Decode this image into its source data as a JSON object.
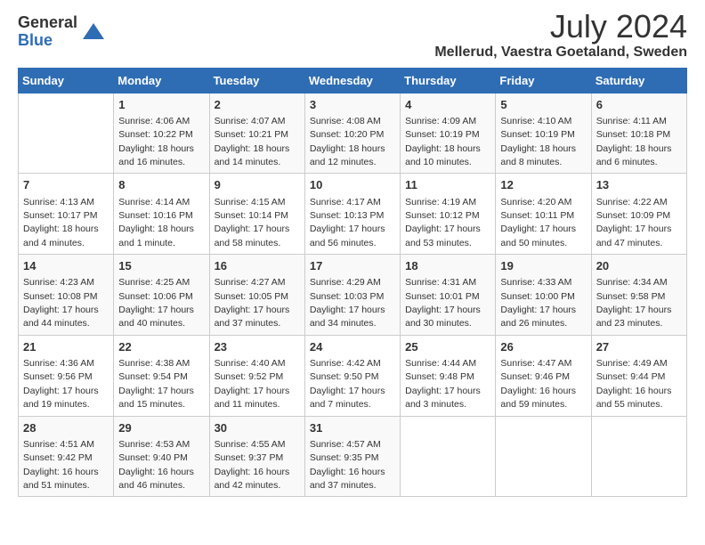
{
  "logo": {
    "general": "General",
    "blue": "Blue"
  },
  "title": "July 2024",
  "location": "Mellerud, Vaestra Goetaland, Sweden",
  "days_of_week": [
    "Sunday",
    "Monday",
    "Tuesday",
    "Wednesday",
    "Thursday",
    "Friday",
    "Saturday"
  ],
  "weeks": [
    [
      {
        "day": "",
        "info": ""
      },
      {
        "day": "1",
        "info": "Sunrise: 4:06 AM\nSunset: 10:22 PM\nDaylight: 18 hours\nand 16 minutes."
      },
      {
        "day": "2",
        "info": "Sunrise: 4:07 AM\nSunset: 10:21 PM\nDaylight: 18 hours\nand 14 minutes."
      },
      {
        "day": "3",
        "info": "Sunrise: 4:08 AM\nSunset: 10:20 PM\nDaylight: 18 hours\nand 12 minutes."
      },
      {
        "day": "4",
        "info": "Sunrise: 4:09 AM\nSunset: 10:19 PM\nDaylight: 18 hours\nand 10 minutes."
      },
      {
        "day": "5",
        "info": "Sunrise: 4:10 AM\nSunset: 10:19 PM\nDaylight: 18 hours\nand 8 minutes."
      },
      {
        "day": "6",
        "info": "Sunrise: 4:11 AM\nSunset: 10:18 PM\nDaylight: 18 hours\nand 6 minutes."
      }
    ],
    [
      {
        "day": "7",
        "info": "Sunrise: 4:13 AM\nSunset: 10:17 PM\nDaylight: 18 hours\nand 4 minutes."
      },
      {
        "day": "8",
        "info": "Sunrise: 4:14 AM\nSunset: 10:16 PM\nDaylight: 18 hours\nand 1 minute."
      },
      {
        "day": "9",
        "info": "Sunrise: 4:15 AM\nSunset: 10:14 PM\nDaylight: 17 hours\nand 58 minutes."
      },
      {
        "day": "10",
        "info": "Sunrise: 4:17 AM\nSunset: 10:13 PM\nDaylight: 17 hours\nand 56 minutes."
      },
      {
        "day": "11",
        "info": "Sunrise: 4:19 AM\nSunset: 10:12 PM\nDaylight: 17 hours\nand 53 minutes."
      },
      {
        "day": "12",
        "info": "Sunrise: 4:20 AM\nSunset: 10:11 PM\nDaylight: 17 hours\nand 50 minutes."
      },
      {
        "day": "13",
        "info": "Sunrise: 4:22 AM\nSunset: 10:09 PM\nDaylight: 17 hours\nand 47 minutes."
      }
    ],
    [
      {
        "day": "14",
        "info": "Sunrise: 4:23 AM\nSunset: 10:08 PM\nDaylight: 17 hours\nand 44 minutes."
      },
      {
        "day": "15",
        "info": "Sunrise: 4:25 AM\nSunset: 10:06 PM\nDaylight: 17 hours\nand 40 minutes."
      },
      {
        "day": "16",
        "info": "Sunrise: 4:27 AM\nSunset: 10:05 PM\nDaylight: 17 hours\nand 37 minutes."
      },
      {
        "day": "17",
        "info": "Sunrise: 4:29 AM\nSunset: 10:03 PM\nDaylight: 17 hours\nand 34 minutes."
      },
      {
        "day": "18",
        "info": "Sunrise: 4:31 AM\nSunset: 10:01 PM\nDaylight: 17 hours\nand 30 minutes."
      },
      {
        "day": "19",
        "info": "Sunrise: 4:33 AM\nSunset: 10:00 PM\nDaylight: 17 hours\nand 26 minutes."
      },
      {
        "day": "20",
        "info": "Sunrise: 4:34 AM\nSunset: 9:58 PM\nDaylight: 17 hours\nand 23 minutes."
      }
    ],
    [
      {
        "day": "21",
        "info": "Sunrise: 4:36 AM\nSunset: 9:56 PM\nDaylight: 17 hours\nand 19 minutes."
      },
      {
        "day": "22",
        "info": "Sunrise: 4:38 AM\nSunset: 9:54 PM\nDaylight: 17 hours\nand 15 minutes."
      },
      {
        "day": "23",
        "info": "Sunrise: 4:40 AM\nSunset: 9:52 PM\nDaylight: 17 hours\nand 11 minutes."
      },
      {
        "day": "24",
        "info": "Sunrise: 4:42 AM\nSunset: 9:50 PM\nDaylight: 17 hours\nand 7 minutes."
      },
      {
        "day": "25",
        "info": "Sunrise: 4:44 AM\nSunset: 9:48 PM\nDaylight: 17 hours\nand 3 minutes."
      },
      {
        "day": "26",
        "info": "Sunrise: 4:47 AM\nSunset: 9:46 PM\nDaylight: 16 hours\nand 59 minutes."
      },
      {
        "day": "27",
        "info": "Sunrise: 4:49 AM\nSunset: 9:44 PM\nDaylight: 16 hours\nand 55 minutes."
      }
    ],
    [
      {
        "day": "28",
        "info": "Sunrise: 4:51 AM\nSunset: 9:42 PM\nDaylight: 16 hours\nand 51 minutes."
      },
      {
        "day": "29",
        "info": "Sunrise: 4:53 AM\nSunset: 9:40 PM\nDaylight: 16 hours\nand 46 minutes."
      },
      {
        "day": "30",
        "info": "Sunrise: 4:55 AM\nSunset: 9:37 PM\nDaylight: 16 hours\nand 42 minutes."
      },
      {
        "day": "31",
        "info": "Sunrise: 4:57 AM\nSunset: 9:35 PM\nDaylight: 16 hours\nand 37 minutes."
      },
      {
        "day": "",
        "info": ""
      },
      {
        "day": "",
        "info": ""
      },
      {
        "day": "",
        "info": ""
      }
    ]
  ]
}
